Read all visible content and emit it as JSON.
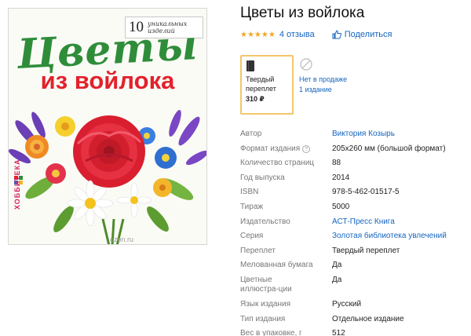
{
  "product": {
    "title": "Цветы из войлока",
    "rating": {
      "stars": "★★★★★",
      "value": 5,
      "reviews_label": "4 отзыва"
    },
    "share_label": "Поделиться"
  },
  "cover": {
    "badge_number": "10",
    "badge_line1": "уникальных",
    "badge_line2": "изделий",
    "title_line1": "Цветы",
    "title_line2": "из войлока",
    "series_mark": "ХОББИТЕКА",
    "watermark": "ozon.ru"
  },
  "formats": {
    "selected": {
      "line1": "Твердый",
      "line2": "переплет",
      "price": "310 ₽"
    },
    "unavailable": {
      "line1": "Нет в продаже",
      "line2": "1 издание"
    }
  },
  "specs": [
    {
      "label": "Автор",
      "value": "Виктория Козырь",
      "link": true
    },
    {
      "label": "Формат издания",
      "value": "205х260 мм (большой формат)",
      "help": true
    },
    {
      "label": "Количество страниц",
      "value": "88"
    },
    {
      "label": "Год выпуска",
      "value": "2014"
    },
    {
      "label": "ISBN",
      "value": "978-5-462-01517-5"
    },
    {
      "label": "Тираж",
      "value": "5000"
    },
    {
      "label": "Издательство",
      "value": "АСТ-Пресс Книга",
      "link": true
    },
    {
      "label": "Серия",
      "value": "Золотая библиотека увлечений",
      "link": true
    },
    {
      "label": "Переплет",
      "value": "Твердый переплет"
    },
    {
      "label": "Мелованная бумага",
      "value": "Да"
    },
    {
      "label": "Цветные иллюстра-ции",
      "value": "Да"
    },
    {
      "label": "Язык издания",
      "value": "Русский"
    },
    {
      "label": "Тип издания",
      "value": "Отдельное издание"
    },
    {
      "label": "Вес в упаковке, г",
      "value": "512"
    }
  ],
  "colors": {
    "link": "#1565c0",
    "star": "#f5a623",
    "selected_border": "#f3c669",
    "cover_title_green": "#2f8d3a",
    "cover_title_red": "#e2222c"
  }
}
